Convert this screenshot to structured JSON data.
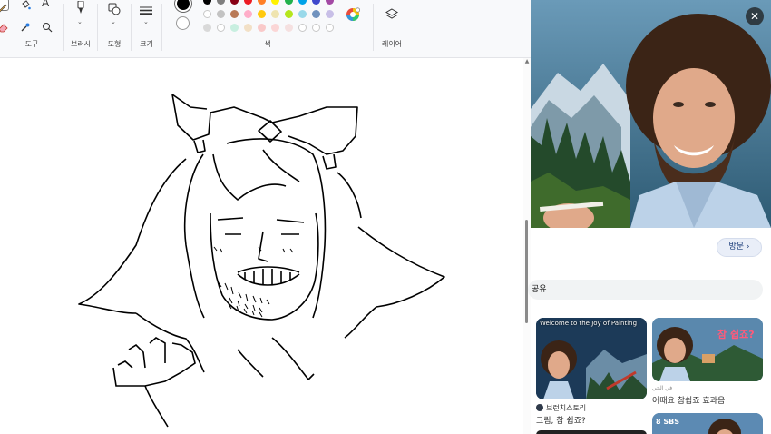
{
  "ribbon": {
    "groups": {
      "tools_label": "도구",
      "brushes_label": "브러시",
      "shapes_label": "도형",
      "size_label": "크기",
      "colors_label": "색",
      "layers_label": "레이어"
    }
  },
  "palette": {
    "primary": "#000000",
    "secondary": "#ffffff",
    "row1": [
      "#000000",
      "#7f7f7f",
      "#880015",
      "#ed1c24",
      "#ff7f27",
      "#fff200",
      "#22b14c",
      "#00a2e8",
      "#3f48cc",
      "#a349a4"
    ],
    "row2": [
      "#ffffff",
      "#c3c3c3",
      "#b97a57",
      "#ffaec9",
      "#ffc90e",
      "#efe4b0",
      "#b5e61d",
      "#99d9ea",
      "#7092be",
      "#c8bfe7"
    ],
    "row3": [
      "#d9d9d9",
      "#ffffff",
      "#c8efe0",
      "#f2e0c6",
      "#f9c9c9",
      "#fbd6d6",
      "#f5e0e0",
      "#ffffff",
      "#ffffff",
      "#ffffff"
    ]
  },
  "viewer": {
    "close_label": "✕",
    "visit_label": "방문 ›",
    "share_label": "공유",
    "cards": [
      {
        "title_banner": "Welcome to the Joy of Painting",
        "source": "브런치스토리",
        "caption": "그림, 참 쉽죠?"
      },
      {
        "overlay_text": "참 쉽죠?",
        "source_small": "في الحي",
        "caption": "어때요 참쉽죠 효과음"
      },
      {
        "badge": "8 SBS"
      }
    ]
  }
}
